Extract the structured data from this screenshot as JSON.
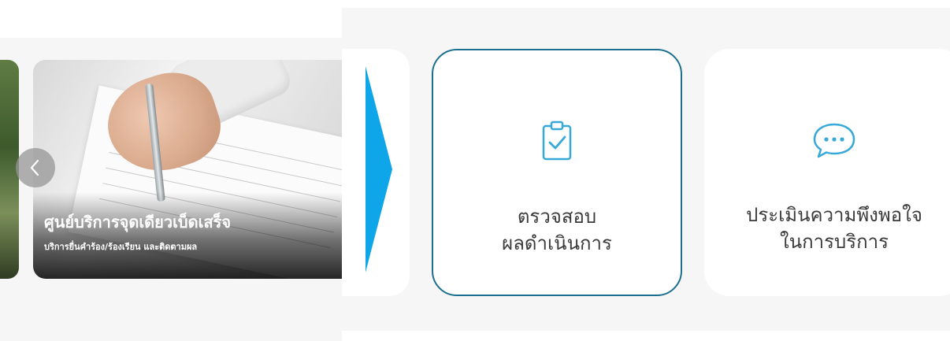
{
  "slider": {
    "title": "ศูนย์บริการจุดเดียวเบ็ดเสร็จ",
    "subtitle": "บริการยื่นคำร้อง/ร้องเรียน และติดตามผล",
    "prev_icon": "chevron-left-icon"
  },
  "services": [
    {
      "line1": "ตรวจสอบ",
      "line2": "ผลดำเนินการ",
      "icon": "clipboard-check-icon",
      "selected": true
    },
    {
      "line1": "ประเมินความพึงพอใจ",
      "line2": "ในการบริการ",
      "icon": "chat-bubble-icon",
      "selected": false
    }
  ],
  "colors": {
    "accent": "#0ea5e9",
    "selected_border": "#1c6f8f",
    "icon_stroke": "#38a9d6",
    "text": "#3a3a3a"
  }
}
